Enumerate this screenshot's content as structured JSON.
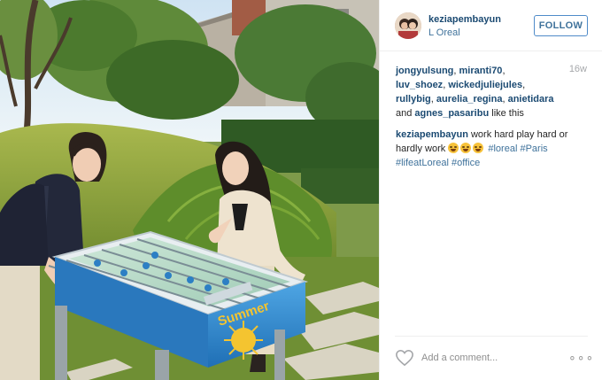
{
  "post": {
    "username": "keziapembayun",
    "location": "L Oreal",
    "follow_label": "FOLLOW",
    "age": "16w",
    "likers": [
      "jongyulsung",
      "miranti70",
      "luv_shoez",
      "wickedjuliejules",
      "rullybig",
      "aurelia_regina",
      "anietidara",
      "agnes_pasaribu"
    ],
    "likes_and": "and",
    "likes_suffix": "like this",
    "caption": {
      "username": "keziapembayun",
      "text": "work hard play hard or hardly work",
      "emoji_count": 3,
      "hashtags": [
        "#loreal",
        "#Paris",
        "#lifeatLoreal",
        "#office"
      ]
    },
    "comment_placeholder": "Add a comment...",
    "more_label": "∘∘∘",
    "photo_text": {
      "table_brand": "Summer"
    }
  },
  "icons": {
    "like": "heart-icon",
    "more": "more-options-icon",
    "avatar": "avatar"
  },
  "colors": {
    "link": "#3f729b",
    "username": "#1b4a72",
    "muted": "#a5a7aa",
    "border": "#efefef",
    "table_blue": "#2c7fc4"
  }
}
